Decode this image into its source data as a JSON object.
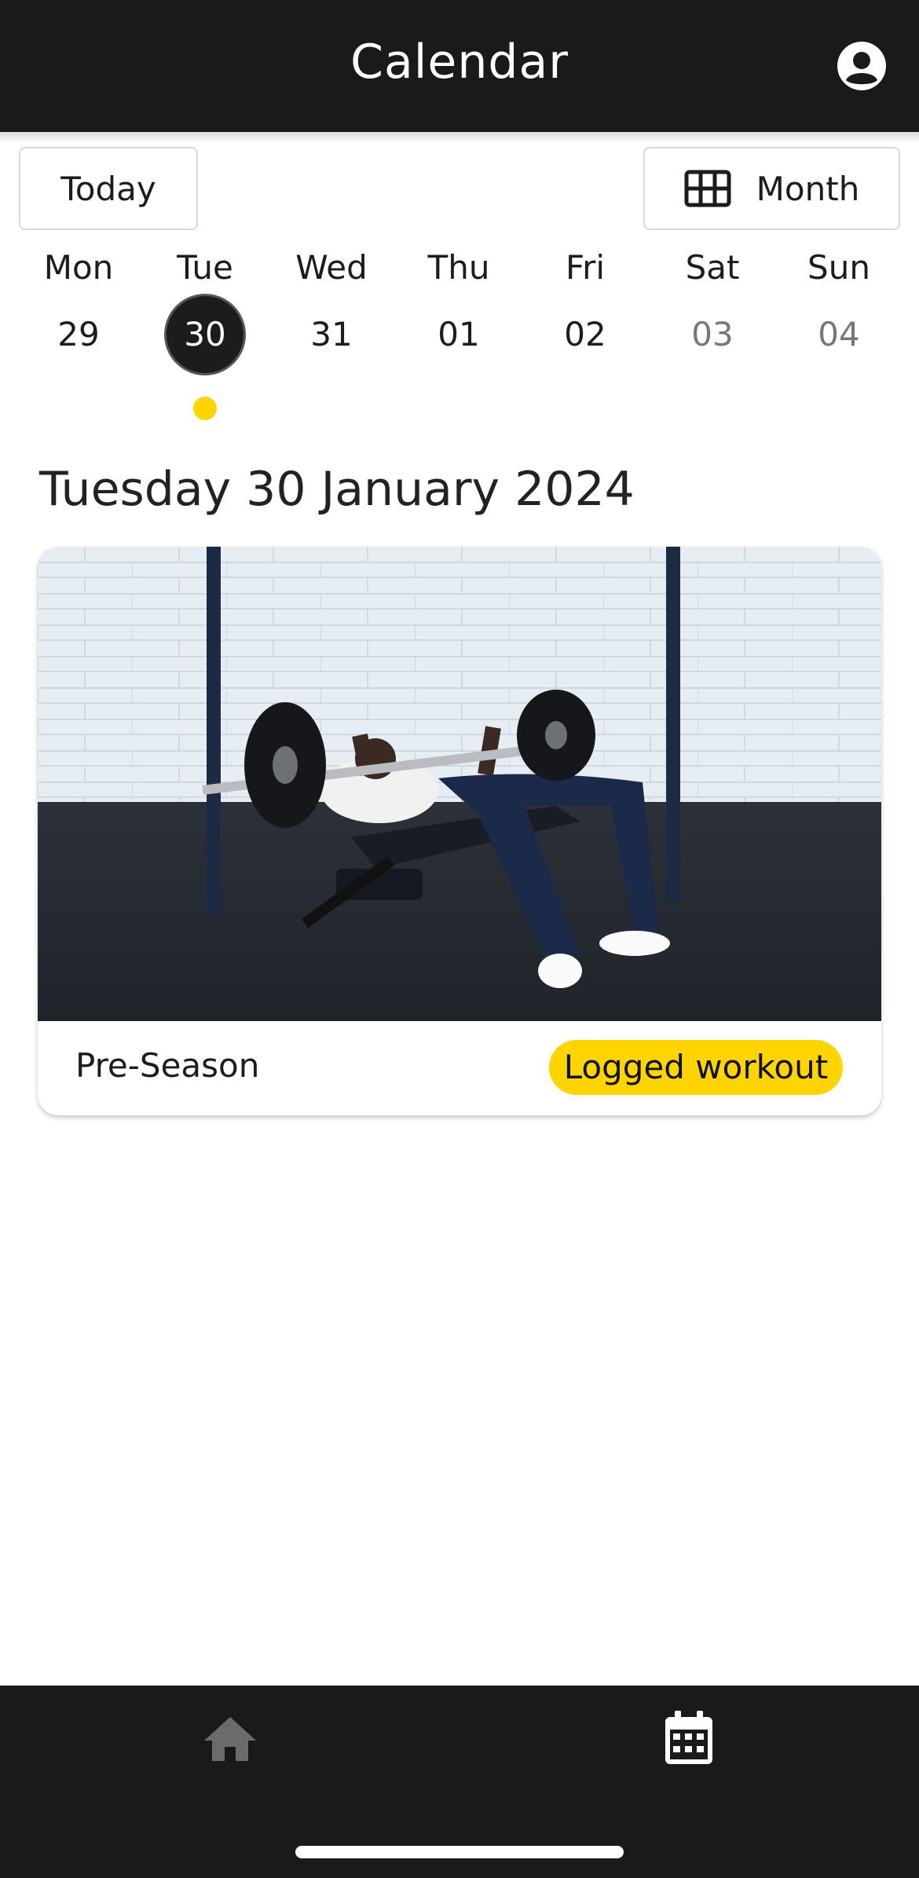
{
  "header": {
    "title": "Calendar",
    "profile_icon": "account-circle-icon"
  },
  "toolbar": {
    "today_label": "Today",
    "view_label": "Month",
    "view_icon": "grid-icon"
  },
  "week": {
    "days": [
      {
        "name": "Mon",
        "date": "29",
        "selected": false,
        "muted": false,
        "has_event": false
      },
      {
        "name": "Tue",
        "date": "30",
        "selected": true,
        "muted": false,
        "has_event": true
      },
      {
        "name": "Wed",
        "date": "31",
        "selected": false,
        "muted": false,
        "has_event": false
      },
      {
        "name": "Thu",
        "date": "01",
        "selected": false,
        "muted": false,
        "has_event": false
      },
      {
        "name": "Fri",
        "date": "02",
        "selected": false,
        "muted": false,
        "has_event": false
      },
      {
        "name": "Sat",
        "date": "03",
        "selected": false,
        "muted": true,
        "has_event": false
      },
      {
        "name": "Sun",
        "date": "04",
        "selected": false,
        "muted": true,
        "has_event": false
      }
    ]
  },
  "selected_date_heading": "Tuesday 30 January 2024",
  "workout_card": {
    "title": "Pre-Season",
    "badge": "Logged workout"
  },
  "bottom_nav": {
    "items": [
      {
        "icon": "home-icon",
        "active": false
      },
      {
        "icon": "calendar-icon",
        "active": true
      }
    ]
  },
  "colors": {
    "bar": "#1a1a1a",
    "accent": "#ffd400",
    "selected_day": "#1c1c1c"
  }
}
